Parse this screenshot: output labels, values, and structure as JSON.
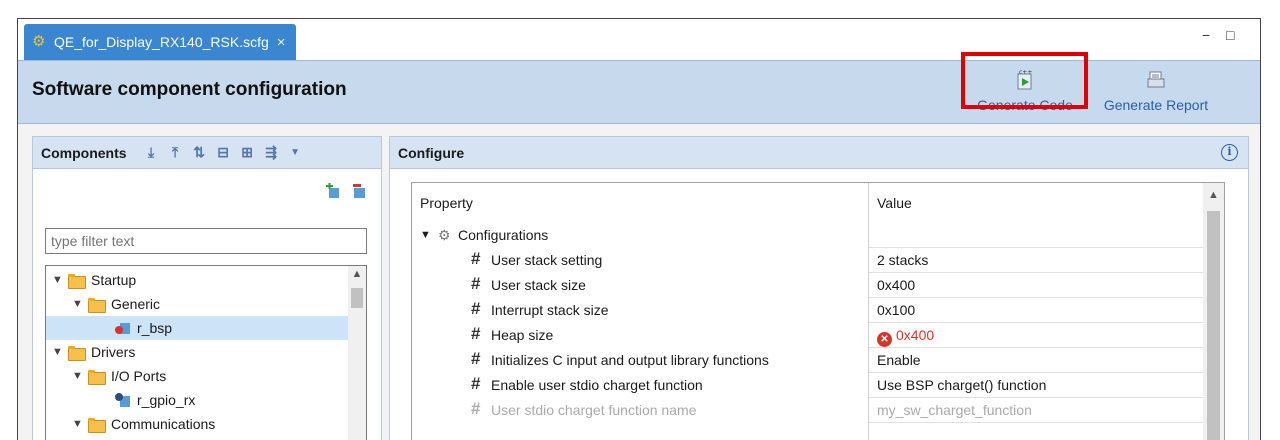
{
  "editor_tab": {
    "title": "QE_for_Display_RX140_RSK.scfg",
    "close": "×",
    "icon": "gear-icon"
  },
  "window_controls": {
    "minimize": "−",
    "maximize": "□"
  },
  "header": {
    "title": "Software component configuration",
    "generate_code_label": "Generate Code",
    "generate_report_label": "Generate Report",
    "highlight_color": "#e00000"
  },
  "components": {
    "title": "Components",
    "filter_placeholder": "type filter text",
    "tree": [
      {
        "label": "Startup",
        "type": "folder",
        "expanded": true
      },
      {
        "label": "Generic",
        "type": "folder",
        "expanded": true
      },
      {
        "label": "r_bsp",
        "type": "component",
        "selected": true
      },
      {
        "label": "Drivers",
        "type": "folder",
        "expanded": true
      },
      {
        "label": "I/O Ports",
        "type": "folder",
        "expanded": true
      },
      {
        "label": "r_gpio_rx",
        "type": "component"
      },
      {
        "label": "Communications",
        "type": "folder",
        "expanded": true
      }
    ]
  },
  "configure": {
    "title": "Configure",
    "columns": {
      "property": "Property",
      "value": "Value"
    },
    "group": "Configurations",
    "rows": [
      {
        "name": "User stack setting",
        "value": "2 stacks"
      },
      {
        "name": "User stack size",
        "value": "0x400"
      },
      {
        "name": "Interrupt stack size",
        "value": "0x100"
      },
      {
        "name": "Heap size",
        "value": "0x400",
        "error": true
      },
      {
        "name": "Initializes C input and output library functions",
        "value": "Enable"
      },
      {
        "name": "Enable user stdio charget function",
        "value": "Use BSP charget() function"
      },
      {
        "name": "User stdio charget function name",
        "value": "my_sw_charget_function",
        "disabled": true
      }
    ],
    "error_color": "#d9342b"
  }
}
